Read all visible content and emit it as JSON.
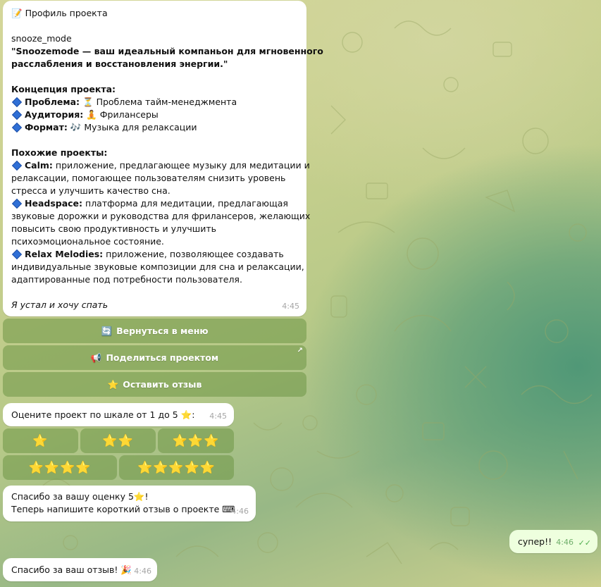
{
  "profile_message": {
    "header_icon": "memo-icon",
    "header": "Профиль проекта",
    "project_name": "snooze_mode",
    "tagline_1": "\"Snoozemode — ваш идеальный компаньон для мгновенного",
    "tagline_2": "расслабления и восстановления энергии.\"",
    "concept_title": "Концепция проекта:",
    "problem_label": "Проблема:",
    "problem_icon": "hourglass-icon",
    "problem_value": "Проблема тайм-менеджмента",
    "audience_label": "Аудитория:",
    "audience_icon": "meditating-person-icon",
    "audience_value": "Фрилансеры",
    "format_label": "Формат:",
    "format_icon": "music-notes-icon",
    "format_value": "Музыка для релаксации",
    "similar_title": "Похожие проекты:",
    "similar": [
      {
        "name": "Calm:",
        "line1": "приложение, предлагающее музыку для медитации и",
        "line2": "релаксации, помогающее пользователям снизить уровень",
        "line3": "стресса и улучшить качество сна."
      },
      {
        "name": "Headspace:",
        "line1": "платформа для медитации, предлагающая",
        "line2": "звуковые дорожки и руководства для фрилансеров, желающих",
        "line3": "повысить свою продуктивность и улучшить",
        "line4": "психоэмоциональное состояние."
      },
      {
        "name": "Relax Melodies:",
        "line1": "приложение, позволяющее создавать",
        "line2": "индивидуальные звуковые композиции для сна и релаксации,",
        "line3": "адаптированные под потребности пользователя."
      }
    ],
    "footer_italic": "Я устал и хочу спать",
    "time": "4:45"
  },
  "keyboard": {
    "back_icon": "refresh-icon",
    "back_label": "Вернуться в меню",
    "share_icon": "megaphone-icon",
    "share_label": "Поделиться проектом",
    "share_arrow": "↗",
    "review_icon": "star-icon",
    "review_label": "Оставить отзыв"
  },
  "rate_message": {
    "text": "Оцените проект по шкале от 1 до 5",
    "icon": "star-icon",
    "suffix": ":",
    "time": "4:45"
  },
  "rating_buttons": [
    "⭐",
    "⭐⭐",
    "⭐⭐⭐",
    "⭐⭐⭐⭐",
    "⭐⭐⭐⭐⭐"
  ],
  "thanks_rating": {
    "line1": "Спасибо за вашу оценку 5",
    "line1_icon": "star-icon",
    "line1_suffix": "!",
    "line2": "Теперь напишите короткий отзыв о проекте",
    "line2_icon": "keyboard-icon",
    "time": "4:46"
  },
  "user_message": {
    "text": "супер!!",
    "time": "4:46",
    "status_icon": "double-check-icon"
  },
  "thanks_review": {
    "text": "Спасибо за ваш отзыв!",
    "icon": "party-popper-icon",
    "time": "4:46"
  },
  "colors": {
    "button_bg": "#6e9646",
    "bubble_bg": "#ffffff",
    "own_bubble_bg": "#eeffde",
    "check_color": "#4fae4e",
    "diamond": "#2f6fd6"
  }
}
